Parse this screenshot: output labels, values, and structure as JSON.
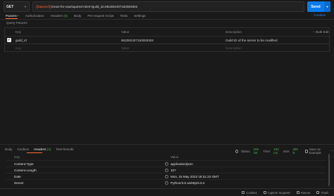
{
  "request": {
    "method": "GET",
    "url_var": "{{baseUrl}}",
    "url_path": "/react-for-raw/squired-roles?guild_id=863362407183083302",
    "send_label": "Send"
  },
  "tabs": [
    {
      "label": "Params",
      "count": "•"
    },
    {
      "label": "Authorization"
    },
    {
      "label": "Headers",
      "count": "(6)"
    },
    {
      "label": "Body"
    },
    {
      "label": "Pre-request Script"
    },
    {
      "label": "Tests"
    },
    {
      "label": "Settings"
    }
  ],
  "cookies_label": "Cookies",
  "query_params_label": "Query Params",
  "params_table": {
    "headers": {
      "key": "Key",
      "value": "Value",
      "description": "Description",
      "bulk": "Bulk Edit"
    },
    "rows": [
      {
        "key": "guild_id",
        "value": "863362407183083302",
        "description": "Guild ID of the server to be modified"
      }
    ],
    "placeholder": {
      "key": "Key",
      "value": "Value",
      "description": "Description"
    }
  },
  "response": {
    "tabs": [
      {
        "label": "Body"
      },
      {
        "label": "Cookies"
      },
      {
        "label": "Headers",
        "count": "(4)"
      },
      {
        "label": "Test Results"
      }
    ],
    "status_label": "Status:",
    "status_value": "200 OK",
    "time_label": "Time:",
    "time_value": "103 ms",
    "size_label": "Size:",
    "size_value": "259 B",
    "save_label": "Save as Example",
    "headers_table": {
      "headers": {
        "key": "Key",
        "value": "Value"
      },
      "rows": [
        {
          "key": "Content-Type",
          "value": "application/json"
        },
        {
          "key": "Content-Length",
          "value": "107"
        },
        {
          "key": "Date",
          "value": "Mon, 15 May 2023 18:31:23 GMT"
        },
        {
          "key": "Server",
          "value": "Python/3.8 aiohttp/3.8.4"
        }
      ]
    }
  },
  "statusbar": {
    "cookies": "Cookies",
    "capture": "Capture requests",
    "runner": "Runner",
    "trash": "Trash"
  },
  "colors": {
    "accent": "#ff6c37",
    "send": "#097bed",
    "ok": "#4caf50"
  }
}
